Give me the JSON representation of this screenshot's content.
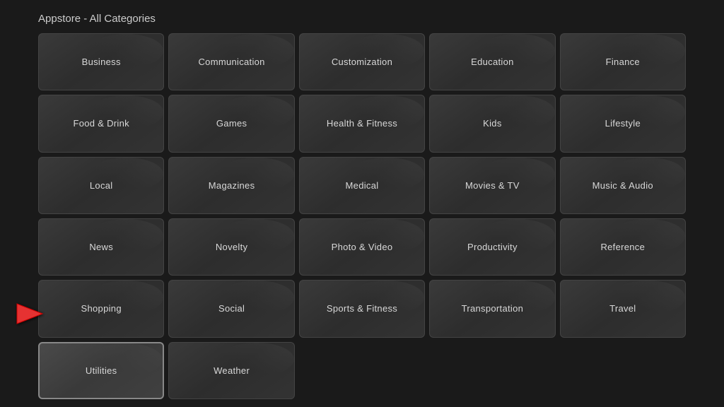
{
  "header": {
    "title": "Appstore - All Categories"
  },
  "categories": [
    {
      "id": "business",
      "label": "Business",
      "selected": false
    },
    {
      "id": "communication",
      "label": "Communication",
      "selected": false
    },
    {
      "id": "customization",
      "label": "Customization",
      "selected": false
    },
    {
      "id": "education",
      "label": "Education",
      "selected": false
    },
    {
      "id": "finance",
      "label": "Finance",
      "selected": false
    },
    {
      "id": "food-drink",
      "label": "Food & Drink",
      "selected": false
    },
    {
      "id": "games",
      "label": "Games",
      "selected": false
    },
    {
      "id": "health-fitness",
      "label": "Health & Fitness",
      "selected": false
    },
    {
      "id": "kids",
      "label": "Kids",
      "selected": false
    },
    {
      "id": "lifestyle",
      "label": "Lifestyle",
      "selected": false
    },
    {
      "id": "local",
      "label": "Local",
      "selected": false
    },
    {
      "id": "magazines",
      "label": "Magazines",
      "selected": false
    },
    {
      "id": "medical",
      "label": "Medical",
      "selected": false
    },
    {
      "id": "movies-tv",
      "label": "Movies & TV",
      "selected": false
    },
    {
      "id": "music-audio",
      "label": "Music & Audio",
      "selected": false
    },
    {
      "id": "news",
      "label": "News",
      "selected": false
    },
    {
      "id": "novelty",
      "label": "Novelty",
      "selected": false
    },
    {
      "id": "photo-video",
      "label": "Photo & Video",
      "selected": false
    },
    {
      "id": "productivity",
      "label": "Productivity",
      "selected": false
    },
    {
      "id": "reference",
      "label": "Reference",
      "selected": false
    },
    {
      "id": "shopping",
      "label": "Shopping",
      "selected": false
    },
    {
      "id": "social",
      "label": "Social",
      "selected": false
    },
    {
      "id": "sports-fitness",
      "label": "Sports & Fitness",
      "selected": false
    },
    {
      "id": "transportation",
      "label": "Transportation",
      "selected": false
    },
    {
      "id": "travel",
      "label": "Travel",
      "selected": false
    },
    {
      "id": "utilities",
      "label": "Utilities",
      "selected": true
    },
    {
      "id": "weather",
      "label": "Weather",
      "selected": false
    }
  ]
}
